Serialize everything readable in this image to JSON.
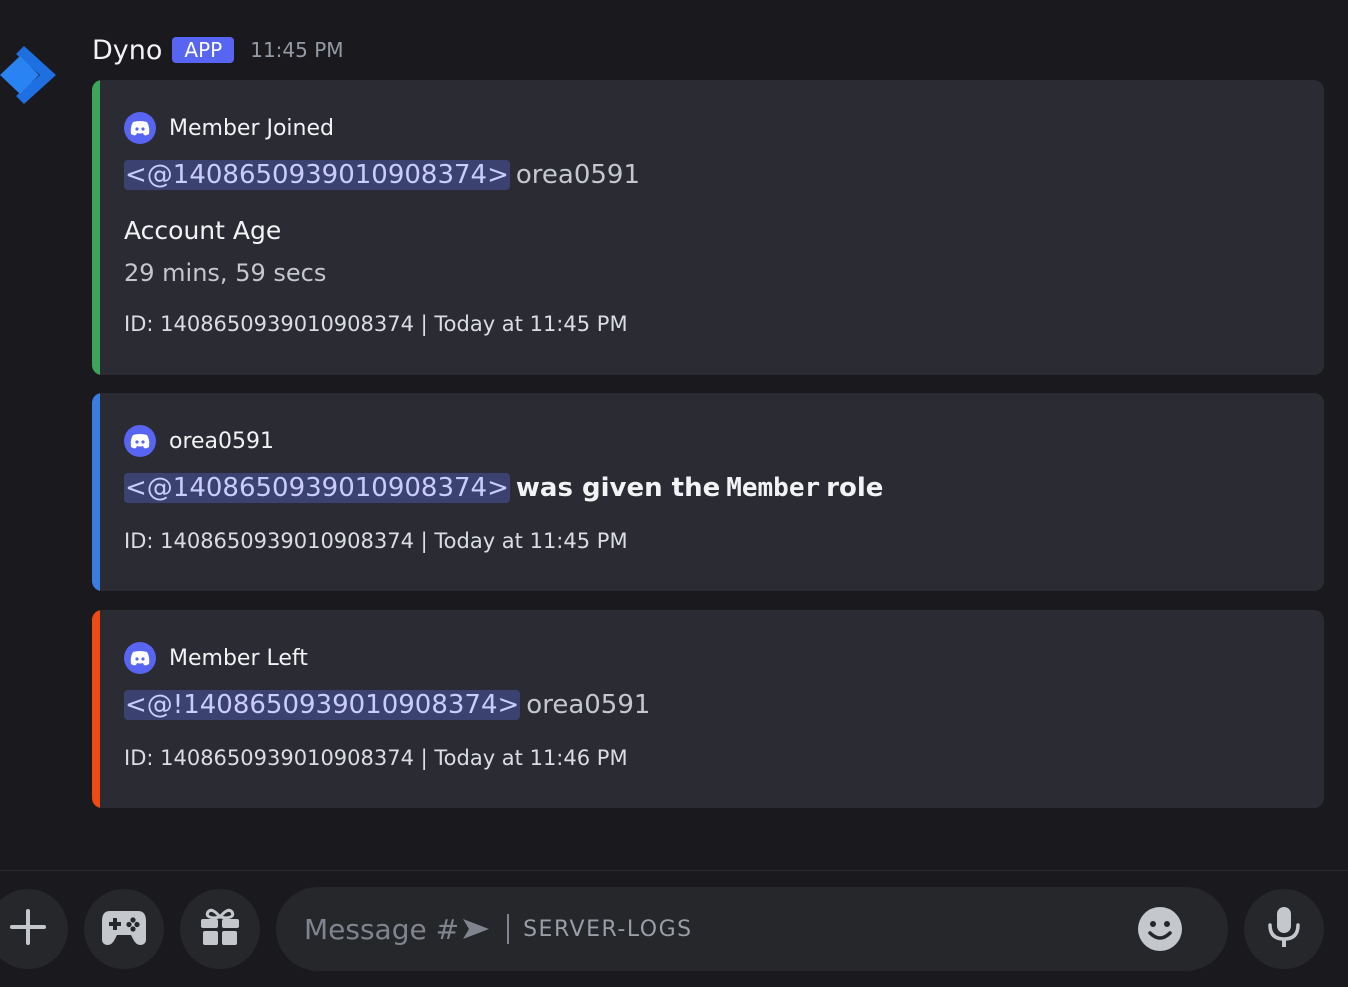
{
  "message": {
    "author": "Dyno",
    "badge": "APP",
    "time": "11:45 PM"
  },
  "embeds": [
    {
      "color": "#3ba55c",
      "author": "Member Joined",
      "mention": "<@1408650939010908374>",
      "username": "orea0591",
      "field_name": "Account Age",
      "field_value": "29 mins, 59 secs",
      "footer": "ID: 1408650939010908374 | Today at 11:45 PM"
    },
    {
      "color": "#3b7ce0",
      "author": "orea0591",
      "mention": "<@1408650939010908374>",
      "text_before": "was given the",
      "role": "Member",
      "text_after": "role",
      "footer": "ID: 1408650939010908374 | Today at 11:45 PM"
    },
    {
      "color": "#f04a14",
      "author": "Member Left",
      "mention": "<@!1408650939010908374>",
      "username": "orea0591",
      "footer": "ID: 1408650939010908374 | Today at 11:46 PM"
    }
  ],
  "composer": {
    "placeholder": "Message #",
    "channel": "SERVER-LOGS"
  },
  "icons": [
    "dyno-logo-icon",
    "discord-icon",
    "plus-icon",
    "gamepad-icon",
    "gift-icon",
    "emoji-icon",
    "microphone-icon"
  ]
}
